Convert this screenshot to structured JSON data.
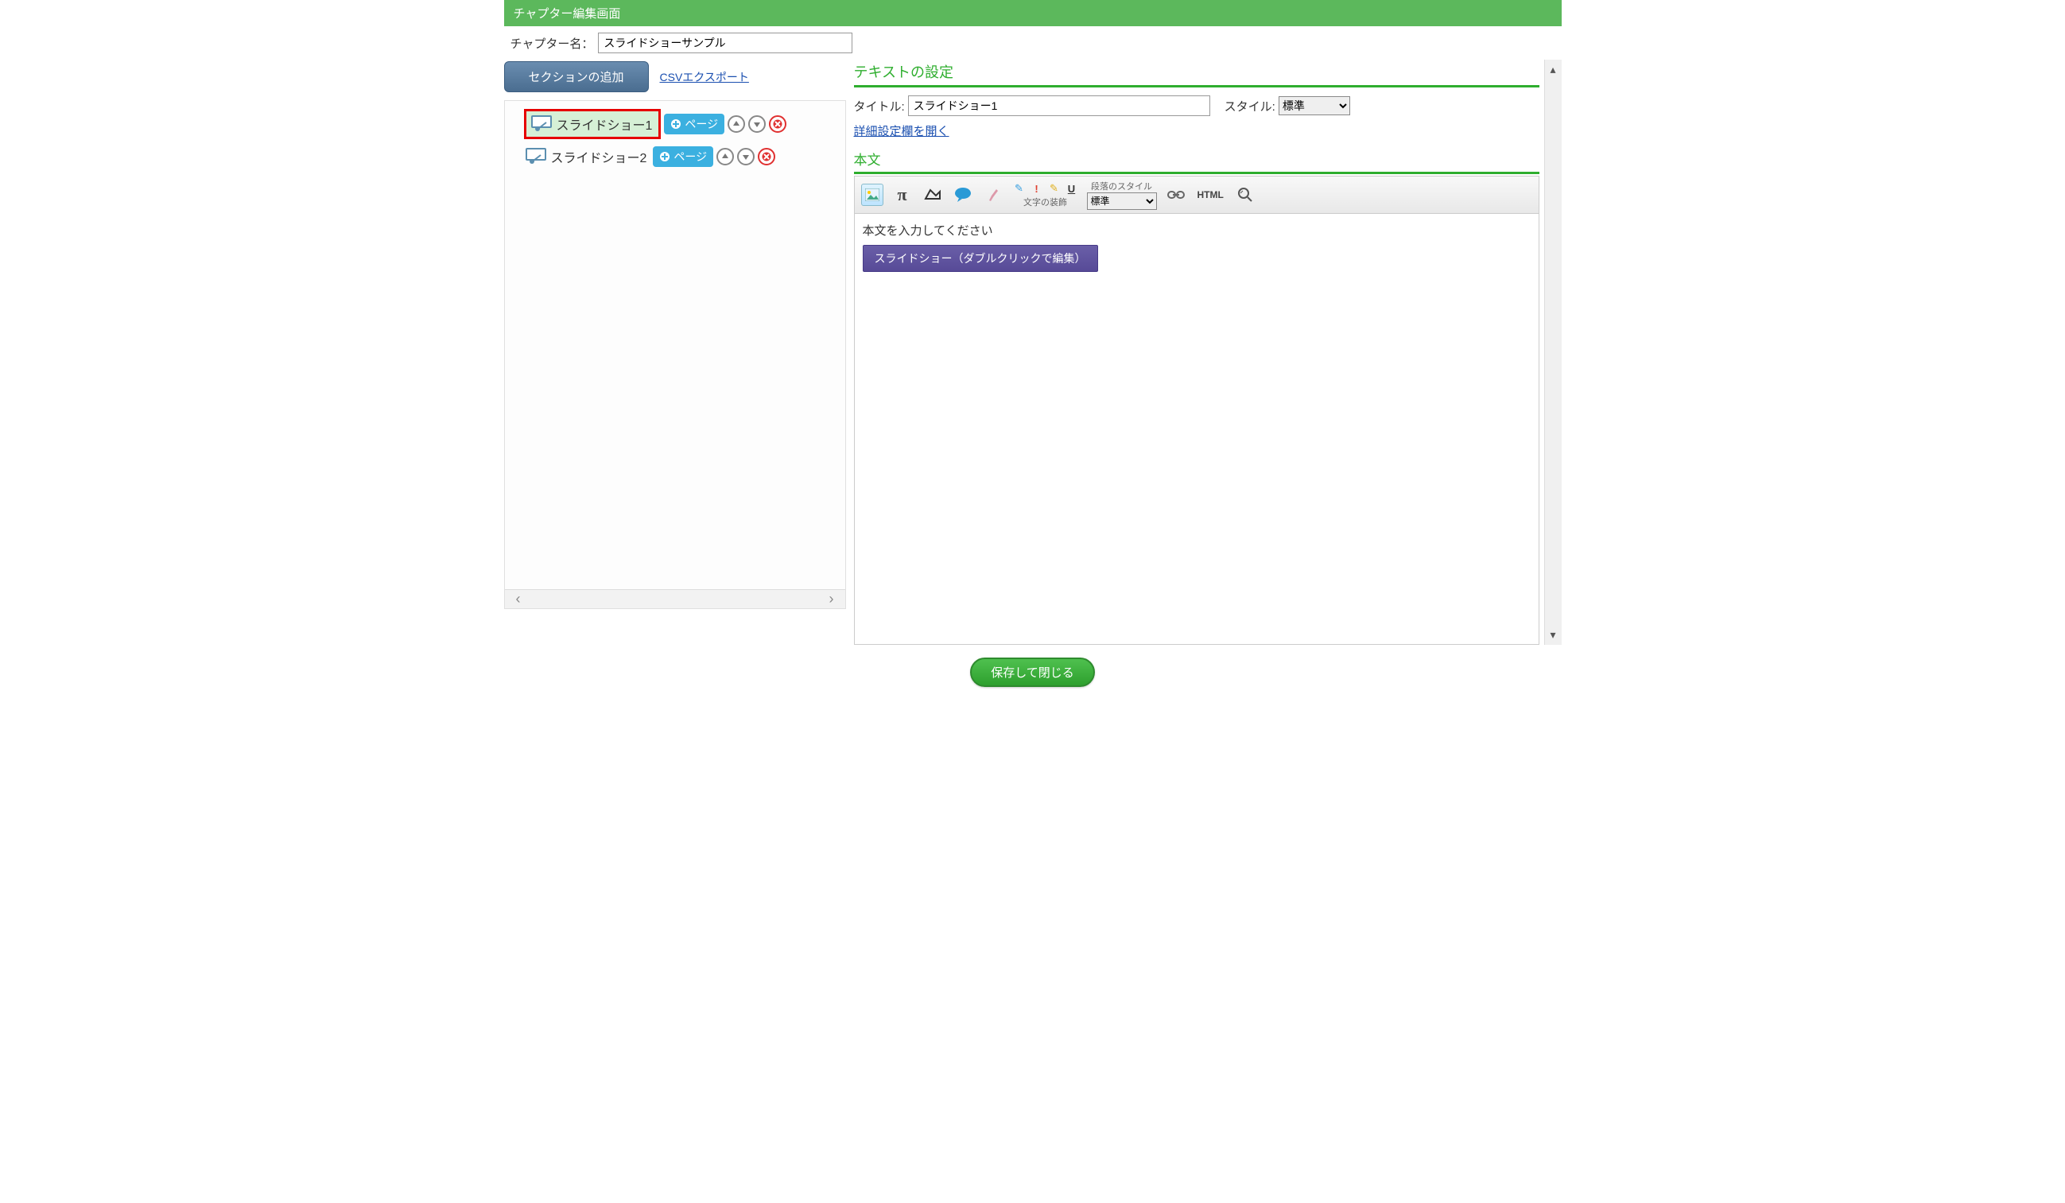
{
  "header": {
    "title": "チャプター編集画面"
  },
  "left": {
    "chapter_name_label": "チャプター名：",
    "chapter_name_value": "スライドショーサンプル",
    "add_section_label": "セクションの追加",
    "csv_export_label": "CSVエクスポート",
    "page_btn_label": "ページ",
    "sections": [
      {
        "label": "スライドショー1",
        "selected": true
      },
      {
        "label": "スライドショー2",
        "selected": false
      }
    ]
  },
  "right": {
    "text_settings_heading": "テキストの設定",
    "title_label": "タイトル:",
    "title_value": "スライドショー1",
    "style_label": "スタイル:",
    "style_value": "標準",
    "detail_link": "詳細設定欄を開く",
    "body_heading": "本文",
    "toolbar": {
      "decoration_label": "文字の装飾",
      "para_style_label": "段落のスタイル",
      "para_style_value": "標準",
      "html_label": "HTML"
    },
    "editor": {
      "placeholder": "本文を入力してください",
      "slideshow_chip": "スライドショー（ダブルクリックで編集）"
    }
  },
  "footer": {
    "save_label": "保存して閉じる"
  }
}
